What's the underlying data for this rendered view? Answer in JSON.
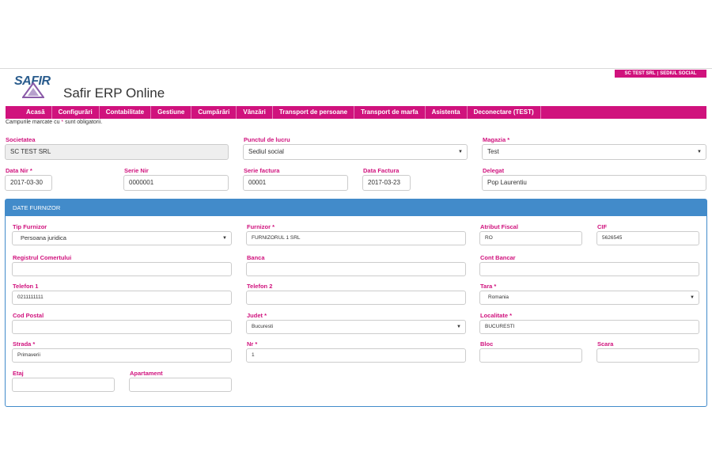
{
  "header": {
    "company_tag": {
      "company": "SC TEST SRL",
      "location": "SEDIUL SOCIAL"
    },
    "logo_text": "SAFIR",
    "app_title": "Safir ERP Online"
  },
  "menu": [
    {
      "label": "Acasă"
    },
    {
      "label": "Configurări"
    },
    {
      "label": "Contabilitate"
    },
    {
      "label": "Gestiune"
    },
    {
      "label": "Cumpărări"
    },
    {
      "label": "Vânzări"
    },
    {
      "label": "Transport de persoane"
    },
    {
      "label": "Transport de marfa"
    },
    {
      "label": "Asistenta"
    },
    {
      "label": "Deconectare (TEST)"
    }
  ],
  "required_note": {
    "before": "Campurile marcate cu ",
    "star": "*",
    "after": " sunt obligatorii."
  },
  "form": {
    "societatea": {
      "label": "Societatea",
      "value": "SC TEST SRL"
    },
    "punct_lucru": {
      "label": "Punctul de lucru",
      "value": "Sediul social"
    },
    "magazia": {
      "label": "Magazia *",
      "value": "Test"
    },
    "data_nir": {
      "label": "Data Nir *",
      "value": "2017-03-30"
    },
    "serie_nir": {
      "label": "Serie Nir",
      "value": "0000001"
    },
    "serie_factura": {
      "label": "Serie factura",
      "value": "00001"
    },
    "data_factura": {
      "label": "Data Factura",
      "value": "2017-03-23"
    },
    "delegat": {
      "label": "Delegat",
      "value": "Pop Laurentiu"
    }
  },
  "supplier_panel": {
    "title": "DATE FURNIZOR",
    "tip_furnizor": {
      "label": "Tip Furnizor",
      "value": "Persoana juridica"
    },
    "furnizor": {
      "label": "Furnizor *",
      "value": "FURNIZORUL 1 SRL"
    },
    "atribut_fiscal": {
      "label": "Atribut Fiscal",
      "value": "RO"
    },
    "cif": {
      "label": "CIF",
      "value": "5626545"
    },
    "registrul_comertului": {
      "label": "Registrul Comertului",
      "value": ""
    },
    "banca": {
      "label": "Banca",
      "value": ""
    },
    "cont_bancar": {
      "label": "Cont Bancar",
      "value": ""
    },
    "telefon1": {
      "label": "Telefon 1",
      "value": "0211111111"
    },
    "telefon2": {
      "label": "Telefon 2",
      "value": ""
    },
    "tara": {
      "label": "Tara *",
      "value": "Romania"
    },
    "cod_postal": {
      "label": "Cod Postal",
      "value": ""
    },
    "judet": {
      "label": "Judet *",
      "value": "Bucuresti"
    },
    "localitate": {
      "label": "Localitate *",
      "value": "BUCURESTI"
    },
    "strada": {
      "label": "Strada *",
      "value": "Primaverii"
    },
    "nr": {
      "label": "Nr *",
      "value": "1"
    },
    "bloc": {
      "label": "Bloc",
      "value": ""
    },
    "scara": {
      "label": "Scara",
      "value": ""
    },
    "etaj": {
      "label": "Etaj",
      "value": ""
    },
    "apartament": {
      "label": "Apartament",
      "value": ""
    }
  },
  "colors": {
    "accent": "#d0127d",
    "panel": "#428bca"
  }
}
